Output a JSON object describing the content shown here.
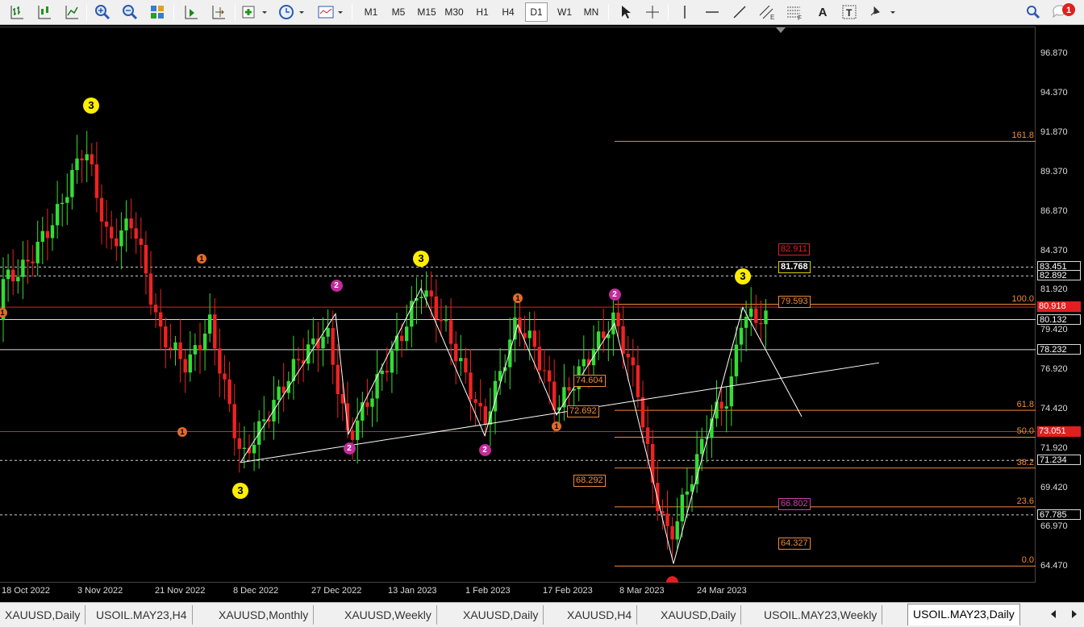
{
  "toolbar": {
    "timeframes": [
      "M1",
      "M5",
      "M15",
      "M30",
      "H1",
      "H4",
      "D1",
      "W1",
      "MN"
    ],
    "active_timeframe": "D1",
    "text_tool": "A",
    "label_tool": "T",
    "notification_count": "1"
  },
  "price_axis": {
    "ticks": [
      "96.870",
      "94.370",
      "91.870",
      "89.370",
      "86.870",
      "84.370",
      "81.920",
      "79.420",
      "76.920",
      "74.420",
      "71.920",
      "69.420",
      "66.970",
      "64.470"
    ],
    "markers": [
      {
        "label": "83.451",
        "style": "white"
      },
      {
        "label": "82.892",
        "style": "white"
      },
      {
        "label": "80.918",
        "style": "red"
      },
      {
        "label": "80.132",
        "style": "white"
      },
      {
        "label": "78.232",
        "style": "white"
      },
      {
        "label": "73.051",
        "style": "red"
      },
      {
        "label": "71.234",
        "style": "white"
      },
      {
        "label": "67.785",
        "style": "white"
      }
    ]
  },
  "time_axis": {
    "labels": [
      "18 Oct 2022",
      "3 Nov 2022",
      "21 Nov 2022",
      "8 Dec 2022",
      "27 Dec 2022",
      "13 Jan 2023",
      "1 Feb 2023",
      "17 Feb 2023",
      "8 Mar 2023",
      "24 Mar 2023"
    ]
  },
  "fibonacci": {
    "levels": [
      "161.8",
      "100.0",
      "61.8",
      "50.0",
      "38.2",
      "23.6",
      "0.0"
    ]
  },
  "chart_boxes": [
    {
      "label": "82.911",
      "style": "red"
    },
    {
      "label": "81.768",
      "style": "yellow"
    },
    {
      "label": "79.593",
      "style": "orange"
    },
    {
      "label": "74.604",
      "style": "orange"
    },
    {
      "label": "72.692",
      "style": "orange"
    },
    {
      "label": "68.292",
      "style": "orange"
    },
    {
      "label": "66.802",
      "style": "magenta"
    },
    {
      "label": "64.327",
      "style": "orange"
    }
  ],
  "waves": [
    {
      "label": "3",
      "kind": "w3"
    },
    {
      "label": "1",
      "kind": "w1"
    },
    {
      "label": "1",
      "kind": "w1"
    },
    {
      "label": "1",
      "kind": "w1"
    },
    {
      "label": "3",
      "kind": "w3"
    },
    {
      "label": "2",
      "kind": "w2"
    },
    {
      "label": "2",
      "kind": "w2"
    },
    {
      "label": "3",
      "kind": "w3"
    },
    {
      "label": "1",
      "kind": "w1"
    },
    {
      "label": "2",
      "kind": "w2"
    },
    {
      "label": "1",
      "kind": "w1"
    },
    {
      "label": "2",
      "kind": "w2"
    },
    {
      "label": "3",
      "kind": "w3"
    }
  ],
  "tabs": [
    "XAUUSD,Daily",
    "USOIL.MAY23,H4",
    "XAUUSD,Monthly",
    "XAUUSD,Weekly",
    "XAUUSD,Daily",
    "XAUUSD,H4",
    "XAUUSD,Daily",
    "USOIL.MAY23,Weekly",
    "USOIL.MAY23,Daily"
  ],
  "active_tab": "USOIL.MAY23,Daily",
  "colors": {
    "bull": "#33dd33",
    "bear": "#ee2222",
    "fib": "#f08a3a",
    "red_line": "#e02020"
  }
}
